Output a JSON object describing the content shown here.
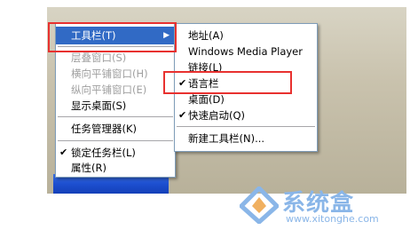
{
  "main_menu": {
    "items": [
      {
        "label": "工具栏(T)",
        "submenu": true,
        "selected": true
      },
      {
        "label": "层叠窗口(S)",
        "disabled": true
      },
      {
        "label": "横向平铺窗口(H)",
        "disabled": true
      },
      {
        "label": "纵向平铺窗口(E)",
        "disabled": true
      },
      {
        "label": "显示桌面(S)"
      },
      {
        "label": "任务管理器(K)"
      },
      {
        "label": "锁定任务栏(L)",
        "checked": true
      },
      {
        "label": "属性(R)"
      }
    ]
  },
  "sub_menu": {
    "items": [
      {
        "label": "地址(A)"
      },
      {
        "label": "Windows Media Player"
      },
      {
        "label": "链接(L)"
      },
      {
        "label": "语言栏",
        "checked": true
      },
      {
        "label": "桌面(D)"
      },
      {
        "label": "快速启动(Q)",
        "checked": true
      },
      {
        "label": "新建工具栏(N)..."
      }
    ]
  },
  "watermark": {
    "brand": "系统盒",
    "url": "www.xitonghe.com"
  },
  "icons": {
    "check": "check-icon",
    "submenu_arrow": "submenu-arrow-icon",
    "logo": "xitonghe-logo-icon"
  },
  "colors": {
    "highlight_box": "#e8312f",
    "selected_item": "#316ac5",
    "disabled_text": "#a0a0a0",
    "taskbar": "#1d4fd0",
    "watermark": "#8ab6e8"
  }
}
